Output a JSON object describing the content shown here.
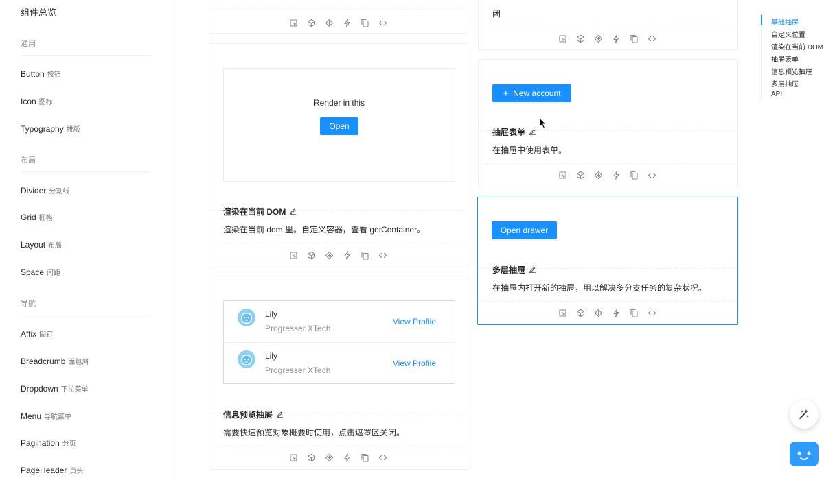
{
  "sidebar": {
    "title": "组件总览",
    "groups": {
      "general": "通用",
      "layout": "布局",
      "nav": "导航"
    },
    "items": [
      {
        "en": "Button",
        "cn": "按钮"
      },
      {
        "en": "Icon",
        "cn": "图标"
      },
      {
        "en": "Typography",
        "cn": "排版"
      },
      {
        "en": "Divider",
        "cn": "分割线"
      },
      {
        "en": "Grid",
        "cn": "栅格"
      },
      {
        "en": "Layout",
        "cn": "布局"
      },
      {
        "en": "Space",
        "cn": "间距"
      },
      {
        "en": "Affix",
        "cn": "固钉"
      },
      {
        "en": "Breadcrumb",
        "cn": "面包屑"
      },
      {
        "en": "Dropdown",
        "cn": "下拉菜单"
      },
      {
        "en": "Menu",
        "cn": "导航菜单"
      },
      {
        "en": "Pagination",
        "cn": "分页"
      },
      {
        "en": "PageHeader",
        "cn": "页头"
      }
    ]
  },
  "left_column": {
    "render_demo": {
      "render_text": "Render in this",
      "open_button": "Open",
      "title": "渲染在当前 DOM",
      "desc": "渲染在当前 dom 里。自定义容器，查看 getContainer。"
    },
    "info_demo": {
      "list": [
        {
          "name": "Lily",
          "desc": "Progresser XTech",
          "link": "View Profile"
        },
        {
          "name": "Lily",
          "desc": "Progresser XTech",
          "link": "View Profile"
        }
      ],
      "title": "信息预览抽屉",
      "desc": "需要快速预览对象概要时使用，点击遮罩区关闭。"
    }
  },
  "right_column": {
    "top_card_text": "闭",
    "form_demo": {
      "button": "New account",
      "title": "抽屉表单",
      "desc": "在抽屉中使用表单。"
    },
    "multi_demo": {
      "button": "Open drawer",
      "title": "多层抽屉",
      "desc": "在抽屉内打开新的抽屉，用以解决多分支任务的复杂状况。"
    }
  },
  "anchor": {
    "items": [
      "基础抽屉",
      "自定义位置",
      "渲染在当前 DOM",
      "抽屉表单",
      "信息预览抽屉",
      "多层抽屉",
      "API"
    ],
    "active_index": 0
  },
  "colors": {
    "primary": "#1890ff",
    "border": "#f0f0f0"
  },
  "icons": {
    "action_icons": [
      "codesandbox-icon",
      "codepen-icon",
      "stackblitz-icon",
      "lightning-icon",
      "copy-icon",
      "code-icon"
    ],
    "edit": "edit-icon",
    "plus": "plus-icon",
    "fab": "sparkle-icon",
    "bot": "chatbot-icon"
  }
}
